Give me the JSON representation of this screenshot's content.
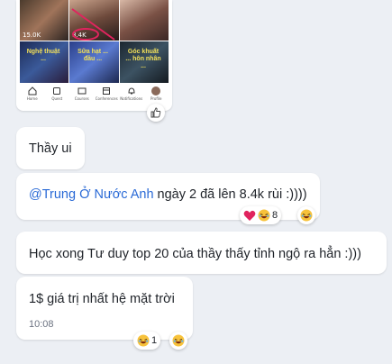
{
  "shared_screenshot": {
    "thumbnails": [
      {
        "views": "15.0K",
        "caption": ""
      },
      {
        "views": "8.4K",
        "caption": ""
      },
      {
        "views": "",
        "caption": ""
      },
      {
        "views": "",
        "caption": "Nghệ thuật ..."
      },
      {
        "views": "",
        "caption": "Sữa hạt ... đầu ..."
      },
      {
        "views": "",
        "caption": "Góc khuất ... hôn nhân ..."
      }
    ],
    "tabs": [
      "Home",
      "Quest",
      "Courses",
      "Conferences",
      "Notifications",
      "Profile"
    ]
  },
  "messages": [
    {
      "text": "Thầy ui"
    },
    {
      "mention": "@Trung Ở Nước Anh",
      "text": " ngày 2 đã lên 8.4k rùi :))))",
      "reactions": {
        "count": "8"
      }
    },
    {
      "text": "Học xong Tư duy top 20 của thầy thấy tỉnh ngộ ra hẳn :)))"
    },
    {
      "text": "1$ giá trị nhất hệ mặt trời",
      "time": "10:08",
      "reactions": {
        "count": "1"
      }
    }
  ],
  "colors": {
    "background": "#eceff4",
    "bubble": "#ffffff",
    "mention": "#2a6ad6",
    "heart": "#e0245e"
  }
}
